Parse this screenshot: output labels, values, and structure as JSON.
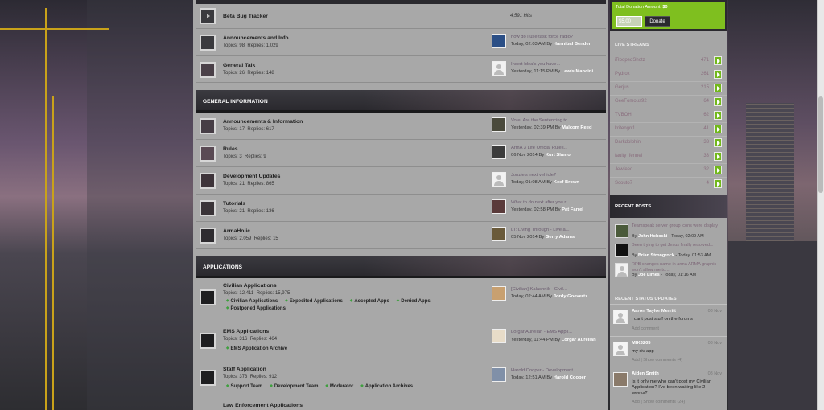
{
  "forum": {
    "top_rows": [
      {
        "title": "Beta Bug Tracker",
        "hits": "4,591 Hits"
      },
      {
        "title": "Announcements and Info",
        "topics_label": "Topics:",
        "topics": "98",
        "replies_label": "Replies:",
        "replies": "1,029",
        "last_title": "how do i use task force radio?",
        "last_when": "Today, 02:03 AM By",
        "last_by": "Hannibal Bender"
      },
      {
        "title": "General Talk",
        "topics_label": "Topics:",
        "topics": "26",
        "replies_label": "Replies:",
        "replies": "148",
        "last_title": "Insert Idea's you have...",
        "last_when": "Yesterday, 11:15 PM By",
        "last_by": "Lewis Mancini"
      }
    ],
    "general": {
      "header": "GENERAL INFORMATION",
      "rows": [
        {
          "title": "Announcements & Information",
          "topics_label": "Topics:",
          "topics": "17",
          "replies_label": "Replies:",
          "replies": "617",
          "last_title": "Vote: Are the Sentencing to...",
          "last_when": "Yesterday, 02:39 PM By",
          "last_by": "Malcom Reed"
        },
        {
          "title": "Rules",
          "topics_label": "Topics:",
          "topics": "3",
          "replies_label": "Replies:",
          "replies": "9",
          "last_title": "ArmA 3 Life Official Rules...",
          "last_when": "06 Nov 2014 By",
          "last_by": "Kurt Slamor"
        },
        {
          "title": "Development Updates",
          "topics_label": "Topics:",
          "topics": "21",
          "replies_label": "Replies:",
          "replies": "865",
          "last_title": "Jonzie's next vehicle?",
          "last_when": "Today, 01:08 AM By",
          "last_by": "Keef Brown"
        },
        {
          "title": "Tutorials",
          "topics_label": "Topics:",
          "topics": "21",
          "replies_label": "Replies:",
          "replies": "136",
          "last_title": "What to do next after you r...",
          "last_when": "Yesterday, 02:58 PM By",
          "last_by": "Pat Farrel"
        },
        {
          "title": "ArmaHolic",
          "topics_label": "Topics:",
          "topics": "2,059",
          "replies_label": "Replies:",
          "replies": "15",
          "last_title": "LT: Living Through - Live a...",
          "last_when": "05 Nov 2014 By",
          "last_by": "Gerry Adams"
        }
      ]
    },
    "applications": {
      "header": "APPLICATIONS",
      "rows": [
        {
          "title": "Civilian Applications",
          "topics_label": "Topics:",
          "topics": "12,411",
          "replies_label": "Replies:",
          "replies": "15,975",
          "subs": [
            "Civilian Applications",
            "Expedited Applications",
            "Accepted Apps",
            "Denied Apps",
            "Postponed Applications"
          ],
          "last_title": "[Civilian] Kalashnik - Civil...",
          "last_when": "Today, 02:44 AM By",
          "last_by": "Jordy Goevertz"
        },
        {
          "title": "EMS Applications",
          "topics_label": "Topics:",
          "topics": "316",
          "replies_label": "Replies:",
          "replies": "464",
          "subs": [
            "EMS Application Archive"
          ],
          "last_title": "Lorgar Aurelian - EMS Appli...",
          "last_when": "Yesterday, 11:44 PM By",
          "last_by": "Lorgar Aurelian"
        },
        {
          "title": "Staff Application",
          "topics_label": "Topics:",
          "topics": "373",
          "replies_label": "Replies:",
          "replies": "912",
          "subs": [
            "Support Team",
            "Development Team",
            "Moderator",
            "Application Archives"
          ],
          "last_title": "Harold Cooper - Development...",
          "last_when": "Today, 12:51 AM By",
          "last_by": "Harold Cooper"
        },
        {
          "title": "Law Enforcement Applications"
        }
      ]
    }
  },
  "sidebar": {
    "donation_label": "Total Donation Amount:",
    "donation_amount": "$0",
    "donation_input": "$5.00",
    "donate_button": "Donate",
    "live_header": "LIVE STREAMS",
    "streams": [
      {
        "name": "iRoopedShotz",
        "count": "471"
      },
      {
        "name": "Pydrox",
        "count": "261"
      },
      {
        "name": "Gerjus",
        "count": "215"
      },
      {
        "name": "GeeFomous92",
        "count": "64"
      },
      {
        "name": "TVBOH",
        "count": "62"
      },
      {
        "name": "kritengrr1",
        "count": "41"
      },
      {
        "name": "Darkdolphin",
        "count": "33"
      },
      {
        "name": "faulty_fennel",
        "count": "33"
      },
      {
        "name": "Jewfeed",
        "count": "32"
      },
      {
        "name": "Scouto7",
        "count": "4"
      }
    ],
    "recent_header": "RECENT POSTS",
    "recent": [
      {
        "title": "Teamspeak server group icons were display",
        "by_prefix": "By",
        "by": "John Hoboski",
        "when": "- Today, 02:09 AM"
      },
      {
        "title": "Been trying to get Jesus finally resolved...",
        "by_prefix": "By",
        "by": "Brian Strongrock",
        "when": "- Today, 01:53 AM"
      },
      {
        "title": "RPB changes name in arma ARMA graphic won't allow me to...",
        "by_prefix": "By",
        "by": "Joe Limes",
        "when": "- Today, 01:16 AM"
      }
    ],
    "status_header": "RECENT STATUS UPDATES",
    "status": [
      {
        "name": "Aaron Taylor Merritt",
        "date": "08 Nov",
        "text": "i cant post stuff on the forums",
        "comment": "Add comment"
      },
      {
        "name": "MIK3205",
        "date": "08 Nov",
        "text": "my civ app",
        "comment": "Add | Show comments (4)"
      },
      {
        "name": "Aiden Smith",
        "date": "08 Nov",
        "text": "Is it only me who can't post my Civilian Application? I've been waiting like 2 weeks?",
        "comment": "Add | Show comments (24)"
      }
    ]
  },
  "colors": {
    "accent_green": "#7fbf1f",
    "header_dark": "#2a292e",
    "panel_grey": "#a8a8a8"
  }
}
